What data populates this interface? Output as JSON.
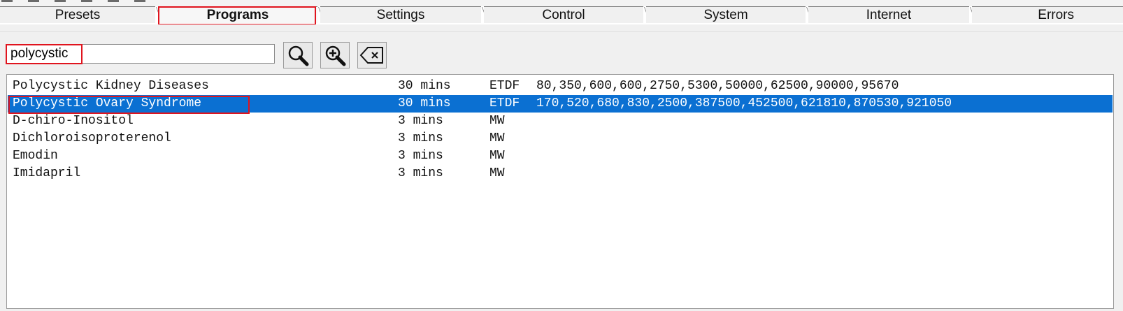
{
  "tabs": [
    "Presets",
    "Programs",
    "Settings",
    "Control",
    "System",
    "Internet",
    "Errors"
  ],
  "active_tab": "Programs",
  "search": {
    "value": "polycystic",
    "placeholder": ""
  },
  "toolbar": {
    "icons": [
      "search-icon",
      "zoom-in-icon",
      "clear-icon"
    ]
  },
  "programs": [
    {
      "name": "Polycystic Kidney Diseases",
      "duration": "30 mins",
      "type": "ETDF",
      "values": "80,350,600,600,2750,5300,50000,62500,90000,95670",
      "selected": false
    },
    {
      "name": "Polycystic Ovary Syndrome",
      "duration": "30 mins",
      "type": "ETDF",
      "values": "170,520,680,830,2500,387500,452500,621810,870530,921050",
      "selected": true
    },
    {
      "name": "D-chiro-Inositol",
      "duration": "3 mins",
      "type": "MW",
      "values": "",
      "selected": false
    },
    {
      "name": "Dichloroisoproterenol",
      "duration": "3 mins",
      "type": "MW",
      "values": "",
      "selected": false
    },
    {
      "name": "Emodin",
      "duration": "3 mins",
      "type": "MW",
      "values": "",
      "selected": false
    },
    {
      "name": "Imidapril",
      "duration": "3 mins",
      "type": "MW",
      "values": "",
      "selected": false
    }
  ],
  "colors": {
    "selection": "#0b70d2",
    "highlight_box": "#e0141e"
  }
}
